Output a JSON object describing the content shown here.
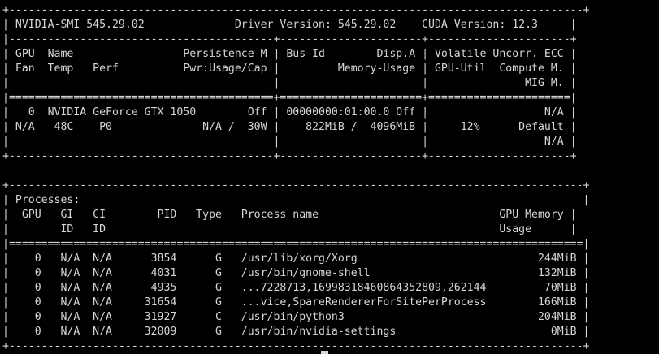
{
  "terminal": {
    "lines": [
      "+-----------------------------------------------------------------------------------------+",
      "| NVIDIA-SMI 545.29.02              Driver Version: 545.29.02    CUDA Version: 12.3     |",
      "|-----------------------------------------+----------------------+----------------------+",
      "| GPU  Name                 Persistence-M | Bus-Id        Disp.A | Volatile Uncorr. ECC |",
      "| Fan  Temp   Perf          Pwr:Usage/Cap |         Memory-Usage | GPU-Util  Compute M. |",
      "|                                         |                      |               MIG M. |",
      "|=========================================+======================+======================|",
      "|   0  NVIDIA GeForce GTX 1050        Off | 00000000:01:00.0 Off |                  N/A |",
      "| N/A   48C    P0              N/A /  30W |    822MiB /  4096MiB |     12%      Default |",
      "|                                         |                      |                  N/A |",
      "+-----------------------------------------+----------------------+----------------------+",
      "",
      "+-----------------------------------------------------------------------------------------+",
      "| Processes:                                                                              |",
      "|  GPU   GI   CI        PID   Type   Process name                            GPU Memory |",
      "|        ID   ID                                                             Usage      |",
      "|=========================================================================================|",
      "|    0   N/A  N/A      3854      G   /usr/lib/xorg/Xorg                            244MiB |",
      "|    0   N/A  N/A      4031      G   /usr/bin/gnome-shell                          132MiB |",
      "|    0   N/A  N/A      4935      G   ...7228713,16998318460864352809,262144         70MiB |",
      "|    0   N/A  N/A     31654      G   ...vice,SpareRendererForSitePerProcess        166MiB |",
      "|    0   N/A  N/A     31927      C   /usr/bin/python3                              204MiB |",
      "|    0   N/A  N/A     32009      G   /usr/bin/nvidia-settings                        0MiB |",
      "+-----------------------------------------------------------------------------------------+"
    ]
  },
  "colors": {
    "background": "#000000",
    "foreground": "#d6d6d6"
  }
}
